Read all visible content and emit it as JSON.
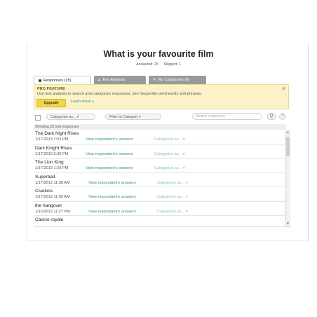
{
  "survey": {
    "title": "What is your favourite film",
    "answered": "Answered: 25",
    "skipped": "Skipped: 1"
  },
  "tabs": [
    {
      "label": "Responses (25)",
      "icon": "dot-icon",
      "active": true
    },
    {
      "label": "Text Analysis",
      "icon": "chart-icon",
      "active": false
    },
    {
      "label": "My Categories (0)",
      "icon": "tag-icon",
      "active": false
    }
  ],
  "pro": {
    "title": "PRO FEATURE",
    "description": "Use text analysis to search and categorize responses; see frequently-used words and phrases.",
    "upgrade_label": "Upgrade",
    "learn_more_label": "Learn more »",
    "close_glyph": "⊗"
  },
  "toolbar": {
    "categorize_label": "Categorize as...",
    "filter_label": "Filter by Category",
    "search_placeholder": "Search responses",
    "search_button": "Q",
    "help": "?"
  },
  "list": {
    "showing": "Showing 25 text responses",
    "view_label": "View respondent's answers",
    "categorize_label": "Categorize as...",
    "rows": [
      {
        "response": "The Dark Night Rises",
        "date": "1/17/2013 7:53 PM"
      },
      {
        "response": "Dark Knight Rises",
        "date": "1/17/2013 5:30 PM"
      },
      {
        "response": "The Lion King",
        "date": "1/17/2013 1:29 PM"
      },
      {
        "response": "Superbad",
        "date": "1/17/2013 11:08 AM"
      },
      {
        "response": "Clueless",
        "date": "1/17/2013 11:05 AM"
      },
      {
        "response": "the hangover",
        "date": "1/16/2013 11:27 PM"
      },
      {
        "response": "Casino royale",
        "date": ""
      }
    ]
  }
}
